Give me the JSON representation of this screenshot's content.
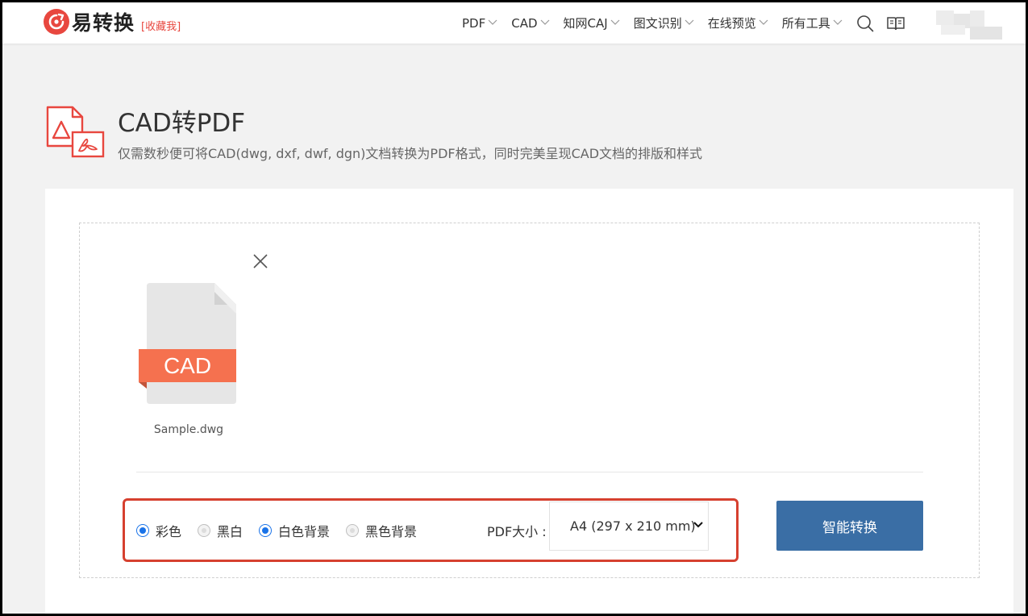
{
  "header": {
    "logo_text": "易转换",
    "bookmark": "[收藏我]",
    "nav": [
      {
        "label": "PDF"
      },
      {
        "label": "CAD"
      },
      {
        "label": "知网CAJ"
      },
      {
        "label": "图文识别"
      },
      {
        "label": "在线预览"
      },
      {
        "label": "所有工具"
      }
    ]
  },
  "page": {
    "title": "CAD转PDF",
    "subtitle": "仅需数秒便可将CAD(dwg, dxf, dwf, dgn)文档转换为PDF格式，同时完美呈现CAD文档的排版和样式"
  },
  "file": {
    "badge": "CAD",
    "name": "Sample.dwg"
  },
  "options": {
    "color_modes": [
      {
        "label": "彩色",
        "selected": true
      },
      {
        "label": "黑白",
        "selected": false
      }
    ],
    "backgrounds": [
      {
        "label": "白色背景",
        "selected": true
      },
      {
        "label": "黑色背景",
        "selected": false
      }
    ],
    "pdf_size_label": "PDF大小 :",
    "pdf_size_value": "A4 (297 x 210 mm)"
  },
  "convert_label": "智能转换",
  "colors": {
    "brand_red": "#e8473f",
    "accent_blue": "#1a73e8",
    "button_blue": "#3a6ea5",
    "highlight_border": "#d6402f",
    "cad_orange": "#f5714f"
  }
}
